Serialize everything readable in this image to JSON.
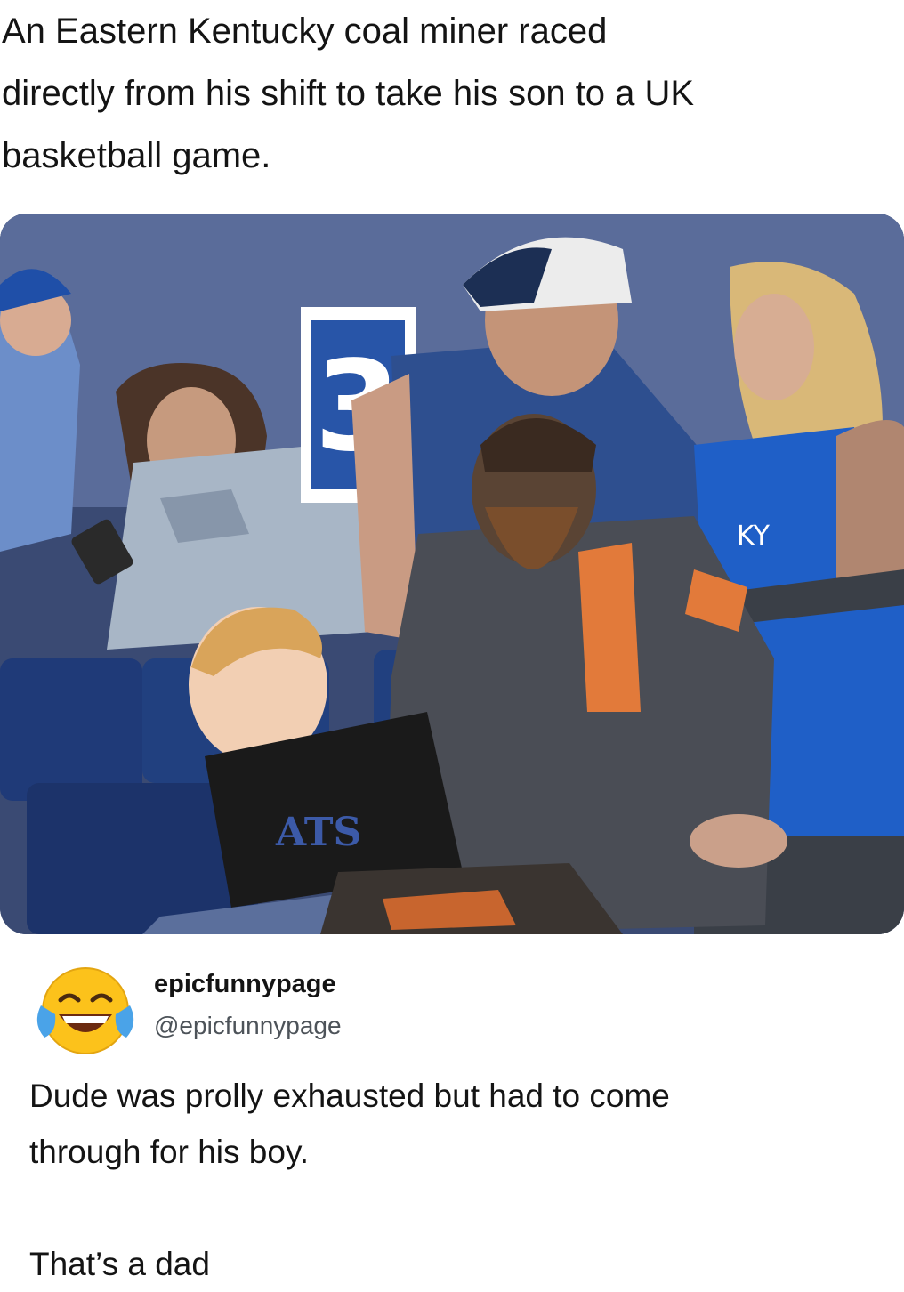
{
  "headline": {
    "line1": "An Eastern Kentucky coal miner raced",
    "line2": "directly from his shift to take his son to a UK",
    "line3": "basketball game."
  },
  "photo": {
    "sign_number": "3",
    "shirt_text": "KY",
    "kid_shirt_text": "ATS"
  },
  "tweet": {
    "display_name": "epicfunnypage",
    "handle": "@epicfunnypage",
    "avatar_icon": "face-with-tears-of-joy-emoji",
    "text_line1": "Dude was prolly exhausted but had to come",
    "text_line2": "through for his boy.",
    "text_line3": "That’s a dad"
  },
  "colors": {
    "text": "#141414",
    "handle": "#4d5359",
    "seat_blue": "#1f3a78",
    "uk_blue": "#1f5fc7"
  }
}
